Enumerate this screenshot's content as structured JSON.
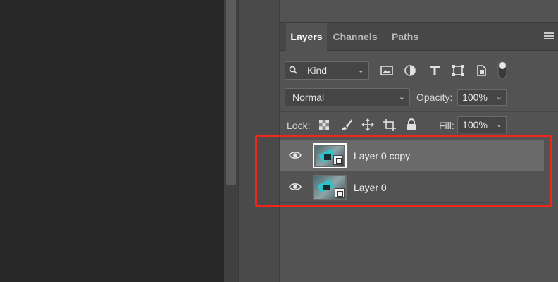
{
  "tabs": [
    {
      "label": "Layers",
      "active": true
    },
    {
      "label": "Channels",
      "active": false
    },
    {
      "label": "Paths",
      "active": false
    }
  ],
  "filter": {
    "kind_label": "Kind",
    "icons": [
      "image-filter-icon",
      "adjustment-filter-icon",
      "type-filter-icon",
      "shape-filter-icon",
      "smart-object-filter-icon",
      "filter-toggle-icon"
    ]
  },
  "blend_mode": "Normal",
  "opacity": {
    "label": "Opacity:",
    "value": "100%"
  },
  "lock": {
    "label": "Lock:",
    "icons": [
      "lock-transparent-icon",
      "lock-brush-icon",
      "lock-position-icon",
      "lock-artboard-icon",
      "lock-all-icon"
    ]
  },
  "fill": {
    "label": "Fill:",
    "value": "100%"
  },
  "layers": [
    {
      "name": "Layer 0 copy",
      "visible": true,
      "selected": true
    },
    {
      "name": "Layer 0",
      "visible": true,
      "selected": false
    }
  ],
  "colors": {
    "panel_bg": "#535353",
    "selected_row": "#6a6a6a",
    "highlight_border": "#f0261b"
  }
}
